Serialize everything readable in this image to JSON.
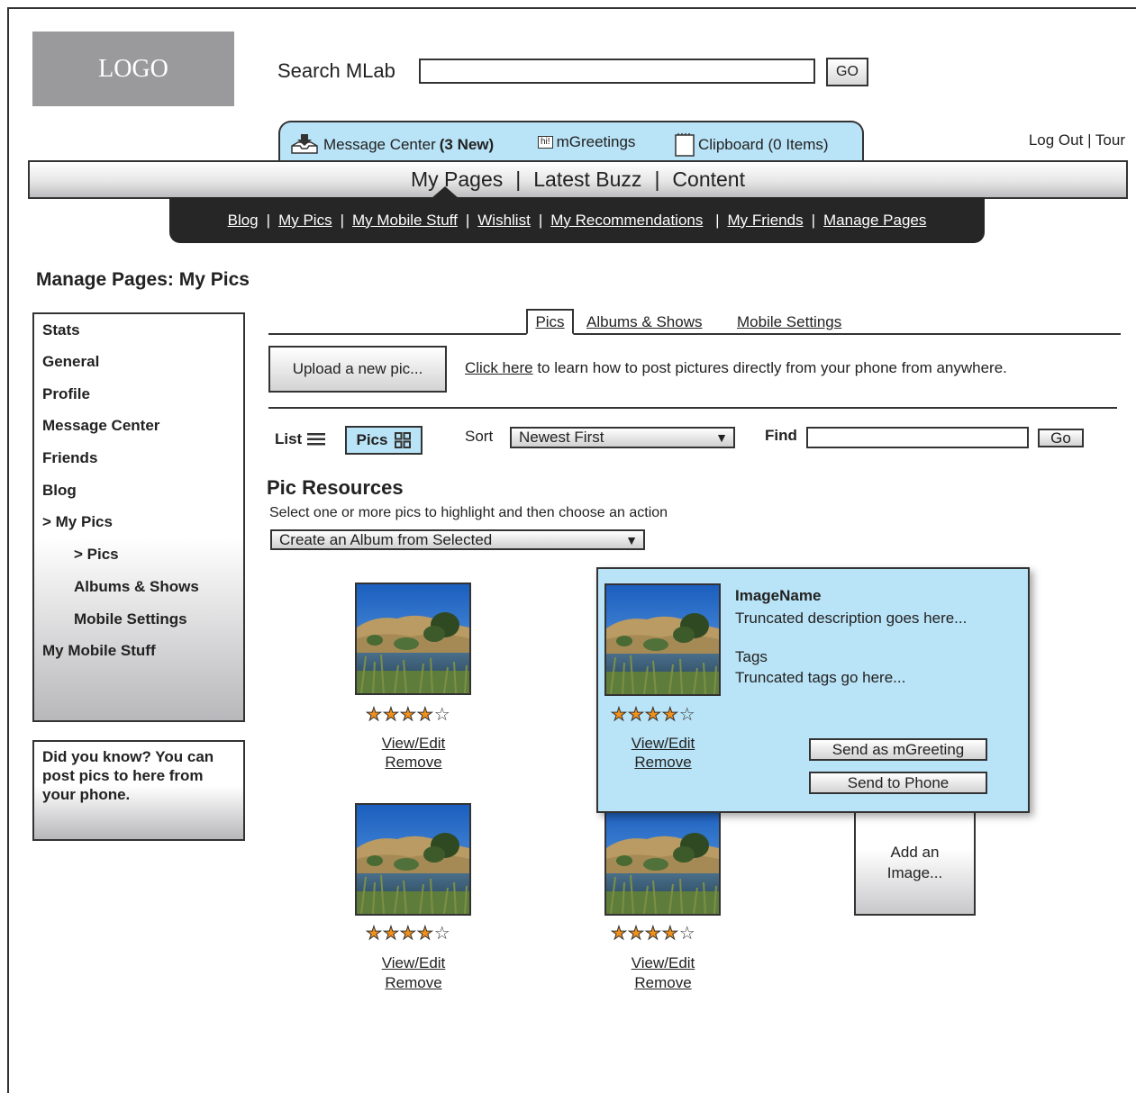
{
  "header": {
    "logo_text": "LOGO",
    "search_label": "Search MLab",
    "search_value": "",
    "search_go": "GO"
  },
  "msgbar": {
    "message_center": "Message Center",
    "message_count": "(3 New)",
    "mgreetings": "mGreetings",
    "mgreetings_icon_text": "hi!",
    "clipboard": "Clipboard (0 Items)"
  },
  "account": {
    "logout": "Log Out",
    "tour": "Tour"
  },
  "mainnav": {
    "items": [
      "My Pages",
      "Latest Buzz",
      "Content"
    ]
  },
  "subnav": {
    "items": [
      "Blog",
      "My Pics",
      "My Mobile Stuff",
      "Wishlist",
      "My Recommendations",
      "My Friends",
      "Manage Pages"
    ]
  },
  "page": {
    "title": "Manage Pages: My Pics"
  },
  "sidebar": {
    "items": [
      "Stats",
      "General",
      "Profile",
      "Message Center",
      "Friends",
      "Blog",
      "> My Pics",
      "> Pics",
      "Albums & Shows",
      "Mobile Settings",
      "My Mobile Stuff"
    ],
    "tip": "Did you know? You can post pics to here from your phone."
  },
  "tabs": {
    "items": [
      "Pics",
      "Albums & Shows",
      "Mobile Settings"
    ]
  },
  "upload": {
    "button": "Upload a new pic...",
    "hint_link": "Click here",
    "hint_rest": " to learn how to post pictures directly from your phone from anywhere."
  },
  "toolbar": {
    "list": "List",
    "pics": "Pics",
    "sort_label": "Sort",
    "sort_value": "Newest First",
    "find_label": "Find",
    "find_value": "",
    "go": "Go"
  },
  "resources": {
    "title": "Pic Resources",
    "instruction": "Select one or more pics to highlight and then choose an action",
    "action_value": "Create an Album from Selected"
  },
  "pics": [
    {
      "rating": 4,
      "max": 5,
      "view_edit": "View/Edit",
      "remove": "Remove"
    },
    {
      "rating": 4,
      "max": 5,
      "view_edit": "View/Edit",
      "remove": "Remove"
    },
    {
      "rating": 4,
      "max": 5,
      "view_edit": "View/Edit",
      "remove": "Remove"
    },
    {
      "rating": 4,
      "max": 5,
      "view_edit": "View/Edit",
      "remove": "Remove"
    }
  ],
  "popup": {
    "image_name": "ImageName",
    "description": "Truncated description goes here...",
    "tags_label": "Tags",
    "tags_value": "Truncated tags go here...",
    "send_mgreeting": "Send as mGreeting",
    "send_phone": "Send to Phone"
  },
  "add_image": {
    "line1": "Add an",
    "line2": "Image..."
  },
  "colors": {
    "accent_blue": "#b9e3f6",
    "dark_nav": "#262626",
    "star_orange": "#f1901a",
    "logo_gray": "#9a9a9c"
  }
}
